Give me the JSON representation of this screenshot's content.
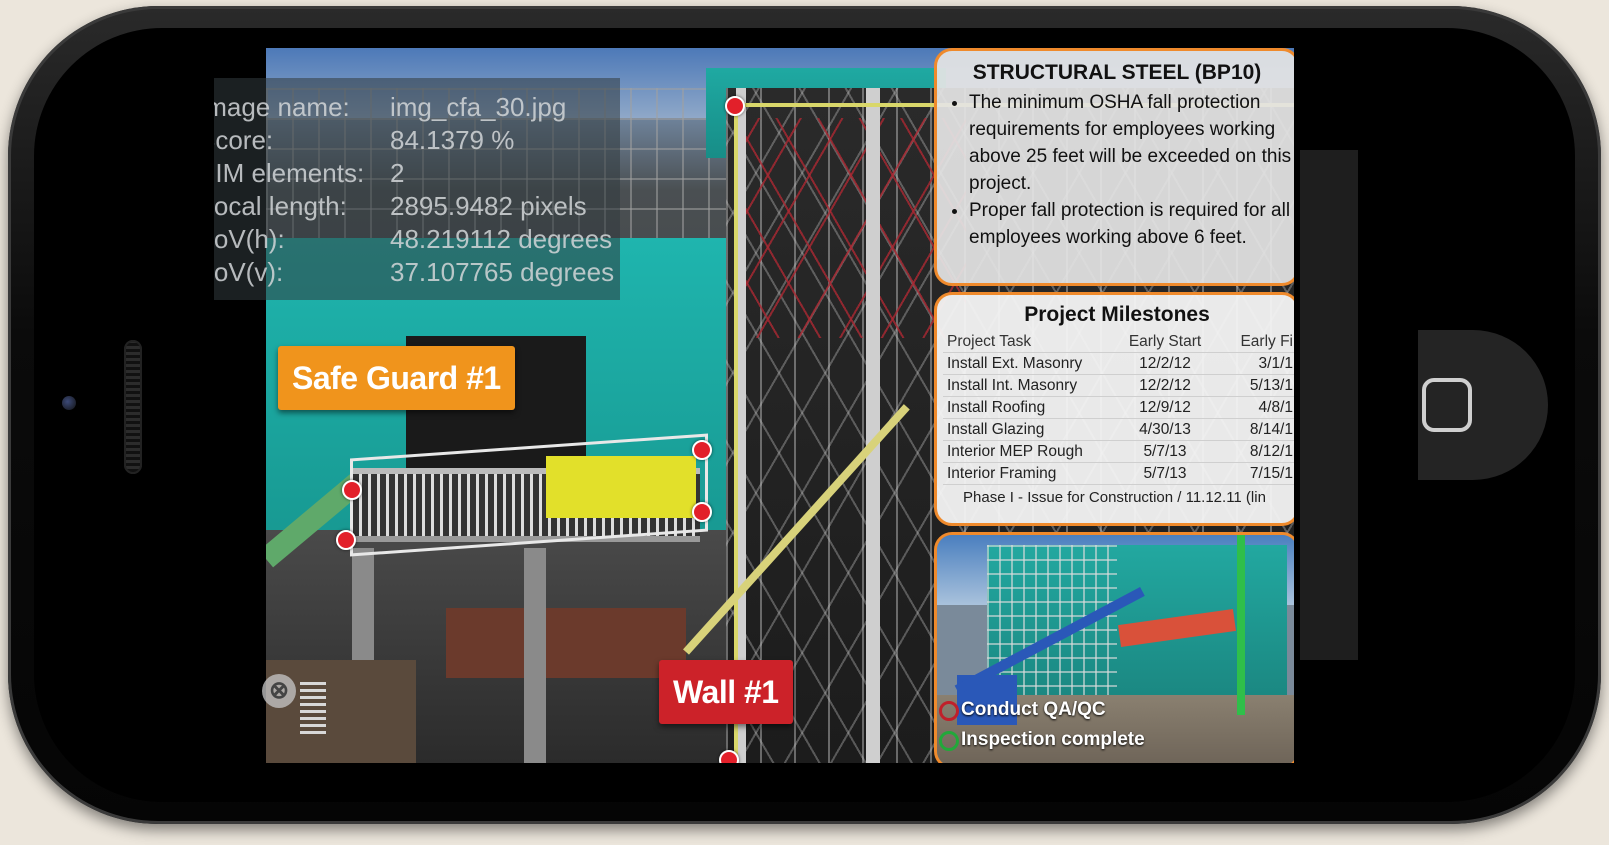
{
  "info_overlay": {
    "rows": [
      {
        "label": "Image name:",
        "value": "img_cfa_30.jpg"
      },
      {
        "label": "Score:",
        "value": "84.1379 %"
      },
      {
        "label": "BIM elements:",
        "value": "2"
      },
      {
        "label": "Focal length:",
        "value": "2895.9482 pixels"
      },
      {
        "label": "FoV(h):",
        "value": "48.219112 degrees"
      },
      {
        "label": "FoV(v):",
        "value": "37.107765 degrees"
      }
    ]
  },
  "tags": {
    "safe_guard": "Safe Guard #1",
    "wall": "Wall #1"
  },
  "steel_panel": {
    "title": "STRUCTURAL STEEL (BP10)",
    "bullets": [
      "The minimum OSHA fall protection requirements for employees working above 25 feet will be exceeded on this project.",
      "Proper fall protection is required for all employees working above 6 feet."
    ]
  },
  "milestones": {
    "title": "Project Milestones",
    "headers": [
      "Project Task",
      "Early Start",
      "Early Fi"
    ],
    "rows": [
      [
        "Install Ext. Masonry",
        "12/2/12",
        "3/1/1"
      ],
      [
        "Install Int. Masonry",
        "12/2/12",
        "5/13/1"
      ],
      [
        "Install Roofing",
        "12/9/12",
        "4/8/1"
      ],
      [
        "Install Glazing",
        "4/30/13",
        "8/14/1"
      ],
      [
        "Interior MEP Rough",
        "5/7/13",
        "8/12/1"
      ],
      [
        "Interior Framing",
        "5/7/13",
        "7/15/1"
      ]
    ],
    "footer": "Phase I - Issue for Construction / 11.12.11 (lin"
  },
  "photo_legend": {
    "items": [
      {
        "label": "Conduct QA/QC",
        "color": "#c0202a"
      },
      {
        "label": "Inspection complete",
        "color": "#22a83a"
      }
    ]
  },
  "colors": {
    "orange_tag": "#f0941c",
    "red_tag": "#cc2229",
    "panel_border": "#ef8a2c",
    "marker": "#e2202a"
  },
  "icons": [
    "close-icon",
    "grip-icon",
    "home-button-icon"
  ]
}
